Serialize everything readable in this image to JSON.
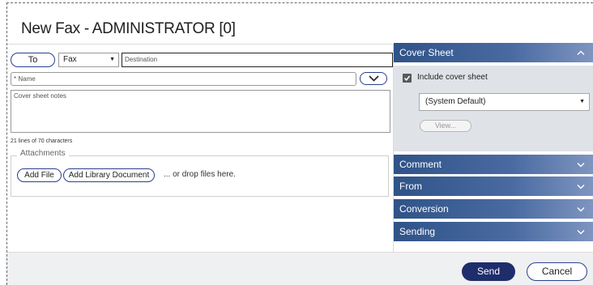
{
  "window": {
    "title": "New Fax - ADMINISTRATOR [0]"
  },
  "recipient": {
    "to_label": "To",
    "type_value": "Fax",
    "destination_placeholder": "Destination",
    "name_placeholder": "* Name"
  },
  "notes": {
    "placeholder": "Cover sheet notes",
    "line_info": "21 lines of 70 characters"
  },
  "attachments": {
    "legend": "Attachments",
    "add_file_label": "Add File",
    "add_library_label": "Add Library Document",
    "drop_text": "... or drop files here."
  },
  "accordion": {
    "cover_sheet": {
      "label": "Cover Sheet",
      "state": "expanded",
      "include_label": "Include cover sheet",
      "include_checked": true,
      "template_value": "(System Default)",
      "view_label": "View..."
    },
    "sections": [
      {
        "label": "Comment",
        "state": "collapsed"
      },
      {
        "label": "From",
        "state": "collapsed"
      },
      {
        "label": "Conversion",
        "state": "collapsed"
      },
      {
        "label": "Sending",
        "state": "collapsed"
      }
    ]
  },
  "footer": {
    "send_label": "Send",
    "cancel_label": "Cancel"
  },
  "colors": {
    "accent_dark": "#1f2d6b",
    "header_gradient_start": "#2f5388",
    "header_gradient_end": "#7f95c0",
    "panel_bg": "#dfe3e8",
    "footer_bg": "#eff0f2"
  },
  "icons": {
    "to_type_caret": "caret-down-icon",
    "name_dropdown": "chevron-down-icon",
    "checkbox": "checkmark-icon",
    "collapse": "chevron-up-icon",
    "expand": "chevron-down-icon"
  }
}
